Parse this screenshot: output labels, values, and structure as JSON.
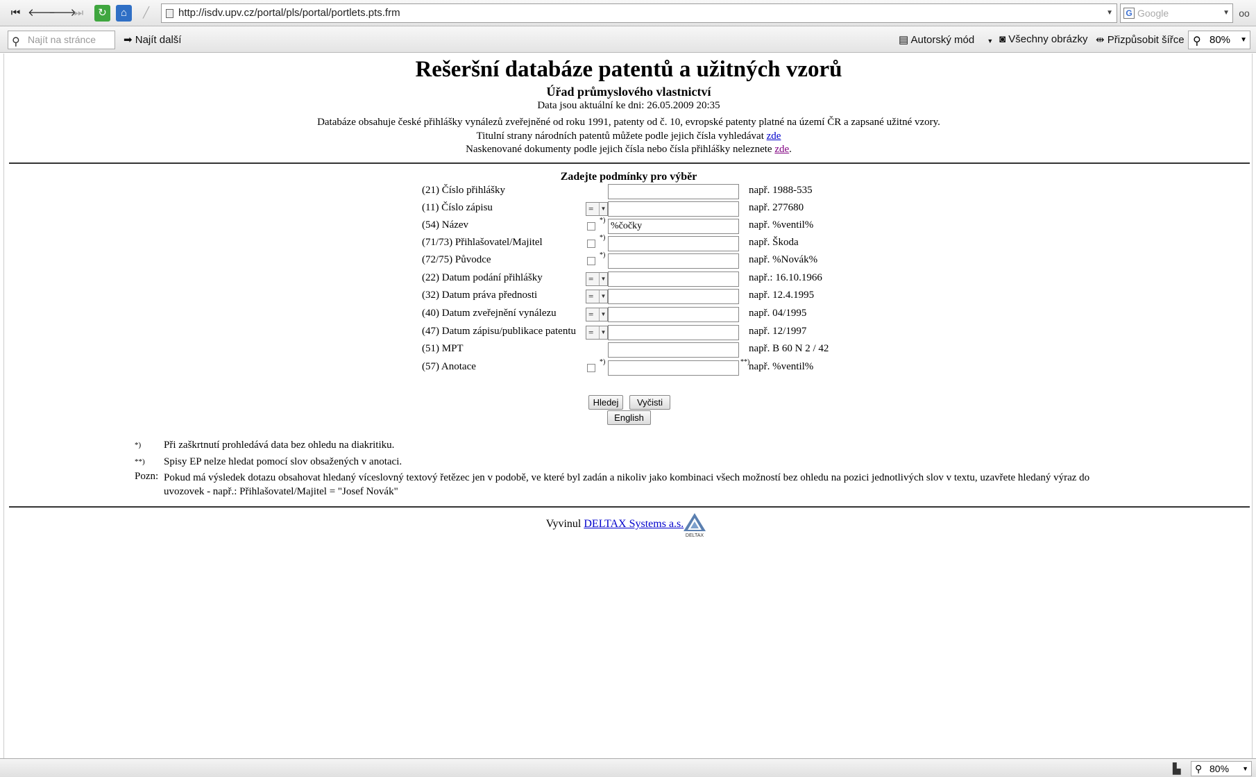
{
  "browser": {
    "url": "http://isdv.upv.cz/portal/pls/portal/portlets.pts.frm",
    "search_placeholder": "Google",
    "find_placeholder": "Najít na stránce",
    "find_next": "Najít další",
    "author_mode": "Autorský mód",
    "all_images": "Všechny obrázky",
    "fit_width": "Přizpůsobit šířce",
    "zoom": "80%",
    "status_zoom": "80%"
  },
  "page": {
    "title": "Rešeršní databáze patentů a užitných vzorů",
    "subtitle": "Úřad průmyslového vlastnictví",
    "updated": "Data jsou aktuální ke dni: 26.05.2009 20:35",
    "description": "Databáze obsahuje české přihlášky vynálezů zveřejněné od roku 1991, patenty od č. 10, evropské patenty platné na území ČR a zapsané užitné vzory.",
    "line2_text": "Titulní strany národních patentů můžete podle jejich čísla vyhledávat ",
    "line2_link": "zde",
    "line3_text": "Naskenované dokumenty podle jejich čísla nebo čísla přihlášky neleznete ",
    "line3_link": "zde",
    "line3_end": "."
  },
  "form": {
    "heading": "Zadejte podmínky pro výběr",
    "rows": [
      {
        "label": "(21) Číslo přihlášky",
        "value": "",
        "example": "např. 1988-535"
      },
      {
        "label": "(11) Číslo zápisu",
        "operator": "=",
        "value": "",
        "example": "např. 277680"
      },
      {
        "label": "(54) Název",
        "value": "%čočky",
        "example": "např. %ventil%"
      },
      {
        "label": "(71/73) Přihlašovatel/Majitel",
        "value": "",
        "example": "např. Škoda"
      },
      {
        "label": "(72/75) Původce",
        "value": "",
        "example": "např. %Novák%"
      },
      {
        "label": "(22) Datum podání přihlášky",
        "operator": "=",
        "value": "",
        "example": "např.: 16.10.1966"
      },
      {
        "label": "(32) Datum práva přednosti",
        "operator": "=",
        "value": "",
        "example": "např. 12.4.1995"
      },
      {
        "label": "(40) Datum zveřejnění vynálezu",
        "operator": "=",
        "value": "",
        "example": "např. 04/1995"
      },
      {
        "label": "(47) Datum zápisu/publikace patentu",
        "operator": "=",
        "value": "",
        "example": "např. 12/1997"
      },
      {
        "label": "(51) MPT",
        "value": "",
        "example": "např. B 60 N 2 / 42"
      },
      {
        "label": "(57) Anotace",
        "value": "",
        "example": "např. %ventil%"
      }
    ],
    "mark1": "*)",
    "mark2": "**)",
    "search_button": "Hledej",
    "clear_button": "Vyčisti",
    "english_button": "English"
  },
  "notes": {
    "n1_sym": "*)",
    "n1": "Při zaškrtnutí prohledává data bez ohledu na diakritiku.",
    "n2_sym": "**)",
    "n2": "Spisy EP nelze hledat pomocí slov obsažených v anotaci.",
    "pozn_label": "Pozn:",
    "pozn": "Pokud má výsledek dotazu obsahovat hledaný víceslovný textový řetězec jen v podobě, ve které byl zadán a nikoliv jako kombinaci všech možností bez ohledu na pozici jednotlivých slov v textu, uzavřete hledaný výraz do uvozovek - např.: Přihlašovatel/Majitel = \"Josef Novák\""
  },
  "footer": {
    "text": "Vyvinul ",
    "link": "DELTAX Systems a.s.",
    "logo_text": "DELTAX"
  }
}
